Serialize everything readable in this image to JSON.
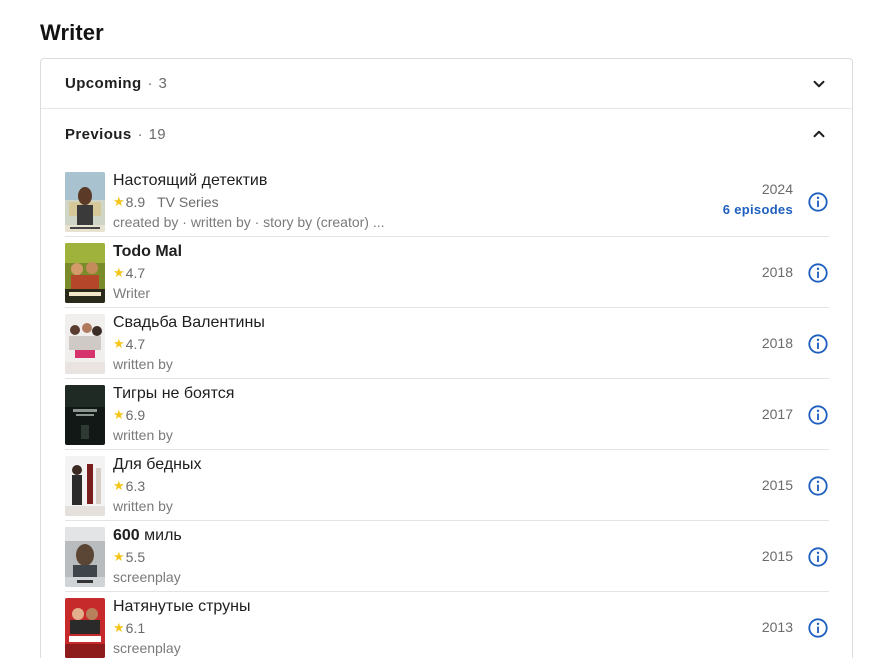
{
  "section": {
    "title": "Writer"
  },
  "accordion": {
    "upcoming": {
      "label": "Upcoming",
      "dot": "·",
      "count": "3"
    },
    "previous": {
      "label": "Previous",
      "dot": "·",
      "count": "19"
    }
  },
  "credits": [
    {
      "title": "Настоящий детектив",
      "rating": "8.9",
      "type": "TV Series",
      "role": "created by · written by · story by (creator) ...",
      "year": "2024",
      "episodes": "6 episodes"
    },
    {
      "title": "Todo Mal",
      "rating": "4.7",
      "type": "",
      "role": "Writer",
      "year": "2018",
      "episodes": ""
    },
    {
      "title": "Свадьба Валентины",
      "rating": "4.7",
      "type": "",
      "role": "written by",
      "year": "2018",
      "episodes": ""
    },
    {
      "title": "Тигры не боятся",
      "rating": "6.9",
      "type": "",
      "role": "written by",
      "year": "2017",
      "episodes": ""
    },
    {
      "title": "Для бедных",
      "rating": "6.3",
      "type": "",
      "role": "written by",
      "year": "2015",
      "episodes": ""
    },
    {
      "title_bold": "600",
      "title_rest": " миль",
      "rating": "5.5",
      "type": "",
      "role": "screenplay",
      "year": "2015",
      "episodes": ""
    },
    {
      "title": "Натянутые струны",
      "rating": "6.1",
      "type": "",
      "role": "screenplay",
      "year": "2013",
      "episodes": ""
    }
  ],
  "icons": {
    "star": "★",
    "info": "info-icon",
    "chevron_down": "chevron-down-icon",
    "chevron_up": "chevron-up-icon"
  },
  "colors": {
    "star": "#f5c518",
    "link": "#1e5fbf",
    "info": "#1e5fbf"
  }
}
